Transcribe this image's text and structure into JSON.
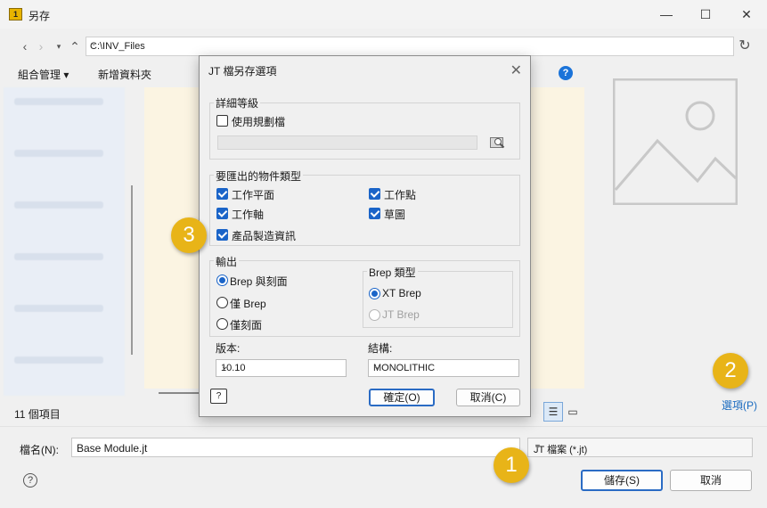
{
  "window": {
    "app_icon": "1",
    "title": "另存",
    "controls": [
      "—",
      "☐",
      "✕"
    ]
  },
  "nav": {
    "back_icon": "arrow-left",
    "forward_icon": "arrow-right",
    "up_icon": "arrow-up",
    "address": "C:\\INV_Files",
    "refresh_icon": "refresh"
  },
  "toolbar": {
    "organize": "組合管理 ▾",
    "new_folder": "新增資料夾",
    "help": "?"
  },
  "status": {
    "item_count": "11 個項目"
  },
  "options_link": "選項(P)",
  "footer": {
    "filename_label": "檔名(N):",
    "filename_value": "Base Module.jt",
    "filetype_value": "JT 檔案 (*.jt)",
    "help": "?",
    "save_label": "儲存(S)",
    "cancel_label": "取消"
  },
  "dialog": {
    "title": "JT 檔另存選項",
    "close": "✕",
    "detail_group": "詳細等級",
    "use_config_label": "使用規劃檔",
    "use_config_checked": false,
    "object_group": "要匯出的物件類型",
    "objects": [
      {
        "label": "工作平面",
        "checked": true
      },
      {
        "label": "工作點",
        "checked": true
      },
      {
        "label": "工作軸",
        "checked": true
      },
      {
        "label": "草圖",
        "checked": true
      },
      {
        "label": "產品製造資訊",
        "checked": true
      }
    ],
    "output_group": "輸出",
    "outputs": [
      {
        "label": "Brep 與刻面",
        "checked": true
      },
      {
        "label": "僅 Brep",
        "checked": false
      },
      {
        "label": "僅刻面",
        "checked": false
      }
    ],
    "brep_group": "Brep 類型",
    "brep_types": [
      {
        "label": "XT Brep",
        "checked": true,
        "disabled": false
      },
      {
        "label": "JT Brep",
        "checked": false,
        "disabled": true
      }
    ],
    "version_label": "版本:",
    "version_value": "10.10",
    "structure_label": "結構:",
    "structure_value": "MONOLITHIC",
    "help": "?",
    "ok_label": "確定(O)",
    "cancel_label": "取消(C)"
  },
  "badges": [
    "1",
    "2",
    "3"
  ],
  "colors": {
    "accent": "#1a64c8",
    "badge": "#e8b418",
    "link": "#1a6bc0"
  }
}
